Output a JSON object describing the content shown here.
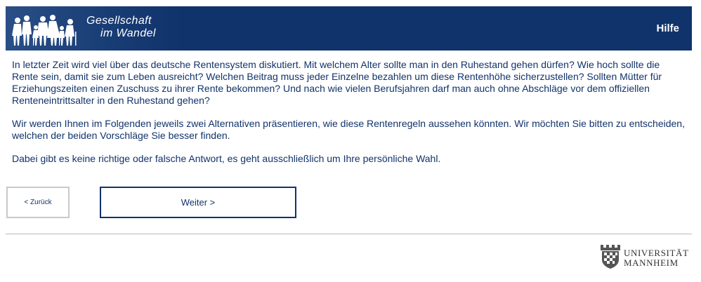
{
  "header": {
    "brand_line1": "Gesellschaft",
    "brand_line2": "im Wandel",
    "help_label": "Hilfe",
    "background_color": "#11336b",
    "logo_icon": "people-silhouettes-icon"
  },
  "main": {
    "paragraphs": [
      "In letzter Zeit wird viel über das deutsche Rentensystem diskutiert. Mit welchem Alter sollte man in den Ruhestand gehen dürfen? Wie hoch sollte die Rente sein, damit sie zum Leben ausreicht? Welchen Beitrag muss jeder Einzelne bezahlen um diese Rentenhöhe sicherzustellen? Sollten Mütter für Erziehungszeiten einen Zuschuss zu ihrer Rente bekommen? Und nach wie vielen Berufsjahren darf man auch ohne Abschläge vor dem offiziellen Renteneintrittsalter in den Ruhestand gehen?",
      "Wir werden Ihnen im Folgenden jeweils zwei Alternativen präsentieren, wie diese Rentenregeln aussehen könnten. Wir möchten Sie bitten zu entscheiden, welchen der beiden Vorschläge Sie besser finden.",
      "Dabei gibt es keine richtige oder falsche Antwort, es geht ausschließlich um Ihre persönliche Wahl."
    ],
    "text_color": "#11336b"
  },
  "nav": {
    "back_label": "< Zurück",
    "next_label": "Weiter >"
  },
  "footer": {
    "university_line1": "UNIVERSITÄT",
    "university_line2": "MANNHEIM",
    "crest_icon": "university-crest-icon"
  }
}
